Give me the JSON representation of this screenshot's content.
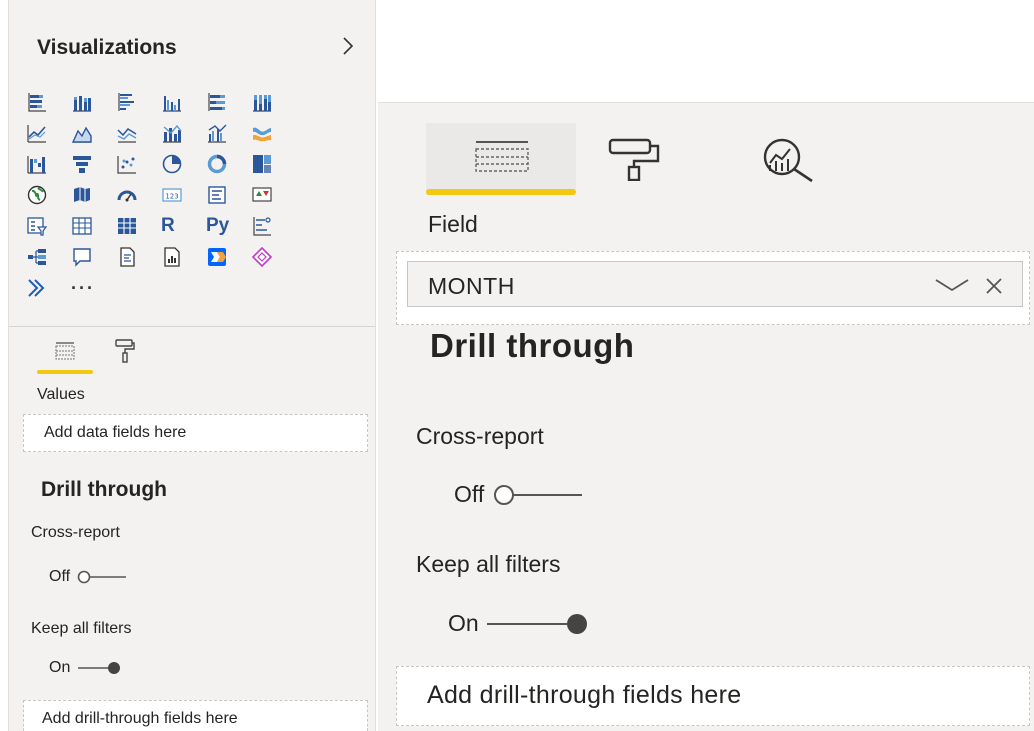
{
  "left_pane": {
    "title": "Visualizations",
    "expand_icon": "chevron-right-icon",
    "viz_icons": [
      "stacked-bar-chart-icon",
      "stacked-column-chart-icon",
      "clustered-bar-chart-icon",
      "clustered-column-chart-icon",
      "100-stacked-bar-chart-icon",
      "100-stacked-column-chart-icon",
      "line-chart-icon",
      "area-chart-icon",
      "stacked-area-chart-icon",
      "line-and-stacked-column-icon",
      "line-and-clustered-column-icon",
      "ribbon-chart-icon",
      "waterfall-chart-icon",
      "funnel-chart-icon",
      "scatter-chart-icon",
      "pie-chart-icon",
      "donut-chart-icon",
      "treemap-icon",
      "map-icon",
      "filled-map-icon",
      "gauge-icon",
      "card-icon",
      "multi-row-card-icon",
      "kpi-icon",
      "slicer-icon",
      "table-icon",
      "matrix-icon",
      "r-script-visual-icon",
      "python-visual-icon",
      "key-influencers-icon",
      "decomposition-tree-icon",
      "qa-icon",
      "smart-narrative-icon",
      "paginated-report-icon",
      "power-automate-icon",
      "power-apps-icon",
      "arcgis-icon",
      "more-visuals-icon"
    ],
    "r_label": "R",
    "py_label": "Py",
    "more_label": "···",
    "tabs": [
      "fields-tab-icon",
      "format-paint-roller-icon"
    ],
    "values_label": "Values",
    "values_placeholder": "Add data fields here",
    "drill_heading": "Drill through",
    "cross_report_label": "Cross-report",
    "cross_report_state": "Off",
    "keep_filters_label": "Keep all filters",
    "keep_filters_state": "On",
    "drill_placeholder": "Add drill-through fields here"
  },
  "right_pane": {
    "tabs": [
      "fields-tab-icon",
      "format-paint-roller-icon",
      "analytics-magnifier-icon"
    ],
    "field_label": "Field",
    "field_value": "MONTH",
    "drill_heading": "Drill through",
    "cross_report_label": "Cross-report",
    "cross_report_state": "Off",
    "keep_filters_label": "Keep all filters",
    "keep_filters_state": "On",
    "drill_placeholder": "Add drill-through fields here"
  },
  "colors": {
    "pane_bg": "#f3f2f1",
    "accent_underline": "#f2c811",
    "icon_blue": "#2b579a",
    "icon_teal": "#118dff",
    "text": "#252423",
    "well_border": "#c8c6c4"
  }
}
